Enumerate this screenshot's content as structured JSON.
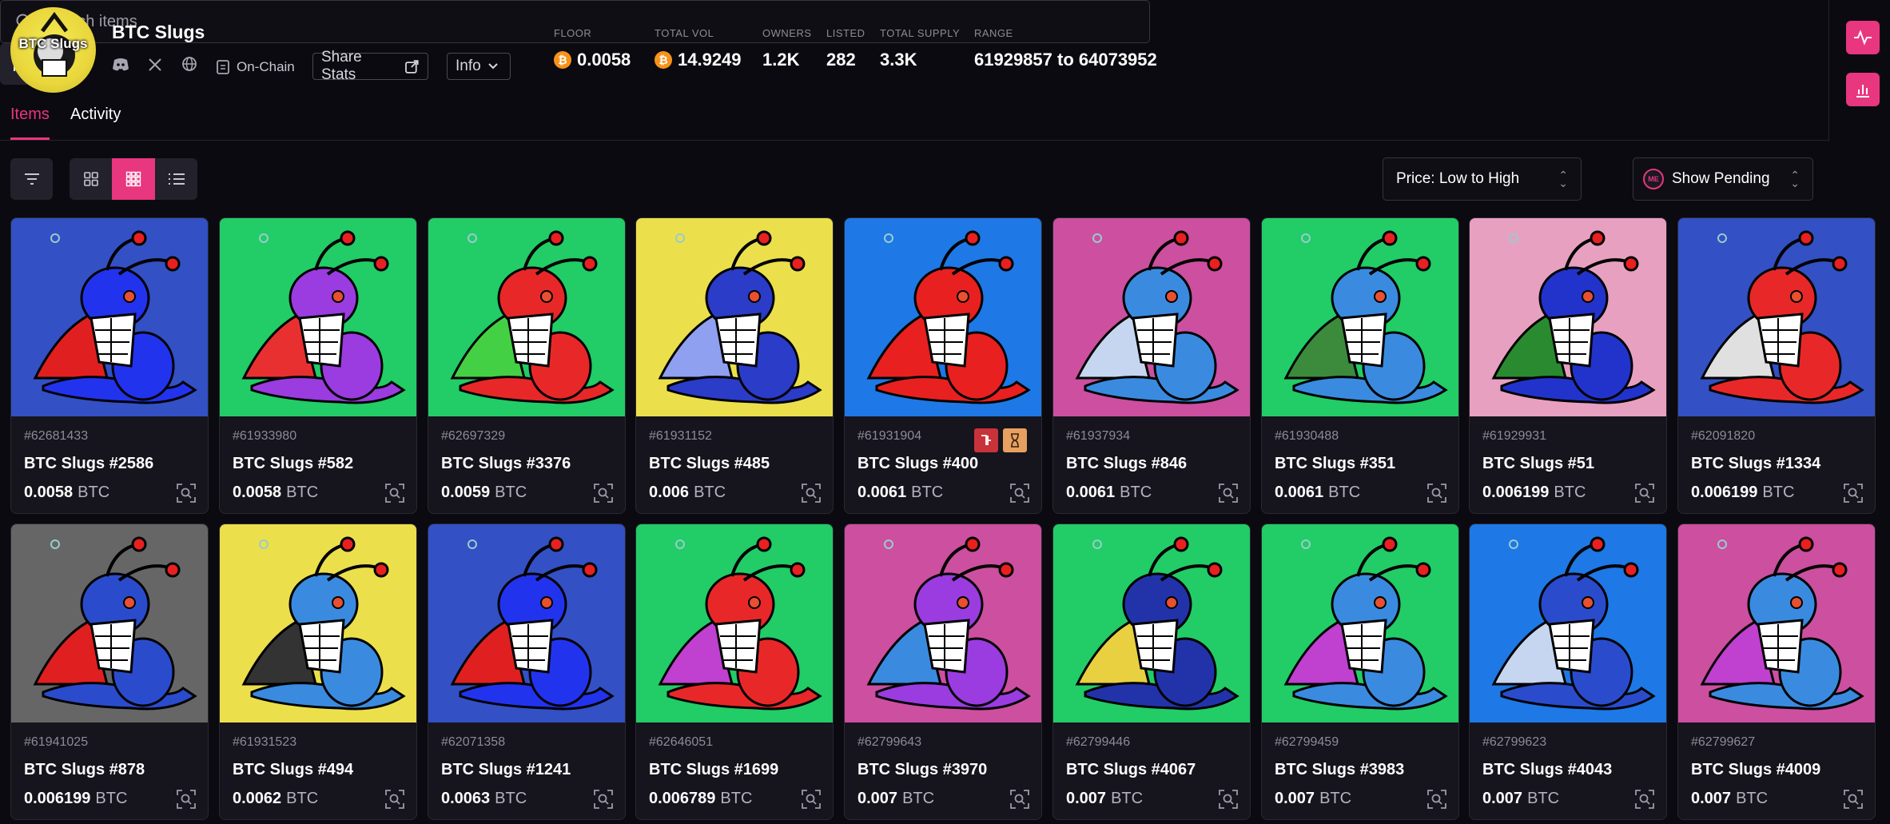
{
  "collection": {
    "name": "BTC Slugs",
    "logo_text": "BTC Slugs"
  },
  "header": {
    "onchain_label": "On-Chain",
    "share_label": "Share Stats",
    "info_label": "Info",
    "stats": [
      {
        "label": "FLOOR",
        "value": "0.0058",
        "btc_icon": true
      },
      {
        "label": "TOTAL VOL",
        "value": "14.9249",
        "btc_icon": true
      },
      {
        "label": "OWNERS",
        "value": "1.2K"
      },
      {
        "label": "LISTED",
        "value": "282"
      },
      {
        "label": "TOTAL SUPPLY",
        "value": "3.3K"
      },
      {
        "label": "RANGE",
        "value": "61929857 to 64073952"
      }
    ]
  },
  "tabs": [
    "Items",
    "Activity"
  ],
  "search": {
    "placeholder": "Search items"
  },
  "sort": {
    "value": "Price: Low to High"
  },
  "pending": {
    "value": "Show Pending",
    "icon_text": "ME"
  },
  "colors": {
    "accent": "#e8367f",
    "bg": "#0b0a10",
    "card": "#16141c",
    "btc": "#f7931a"
  },
  "items": [
    {
      "num": "#62681433",
      "name": "BTC Slugs #2586",
      "price": "0.0058",
      "unit": "BTC",
      "bg": "#3350c4",
      "body": "#2233ee",
      "fin": "#e02020"
    },
    {
      "num": "#61933980",
      "name": "BTC Slugs #582",
      "price": "0.0058",
      "unit": "BTC",
      "bg": "#22cc66",
      "body": "#9a3ce0",
      "fin": "#e83030"
    },
    {
      "num": "#62697329",
      "name": "BTC Slugs #3376",
      "price": "0.0059",
      "unit": "BTC",
      "bg": "#22cc66",
      "body": "#e82828",
      "fin": "#44d044"
    },
    {
      "num": "#61931152",
      "name": "BTC Slugs #485",
      "price": "0.006",
      "unit": "BTC",
      "bg": "#ecdf4c",
      "body": "#2a3cc8",
      "fin": "#8fa0f0"
    },
    {
      "num": "#61931904",
      "name": "BTC Slugs #400",
      "price": "0.0061",
      "unit": "BTC",
      "bg": "#1e78e6",
      "body": "#e82020",
      "fin": "#e82020",
      "badges": true
    },
    {
      "num": "#61937934",
      "name": "BTC Slugs #846",
      "price": "0.0061",
      "unit": "BTC",
      "bg": "#cc4fa0",
      "body": "#3a8be0",
      "fin": "#c6d6f0"
    },
    {
      "num": "#61930488",
      "name": "BTC Slugs #351",
      "price": "0.0061",
      "unit": "BTC",
      "bg": "#22cc66",
      "body": "#3a8be0",
      "fin": "#3c8a3c"
    },
    {
      "num": "#61929931",
      "name": "BTC Slugs #51",
      "price": "0.006199",
      "unit": "BTC",
      "bg": "#e8a0c0",
      "body": "#2233cc",
      "fin": "#2a8a30"
    },
    {
      "num": "#62091820",
      "name": "BTC Slugs #1334",
      "price": "0.006199",
      "unit": "BTC",
      "bg": "#3350c4",
      "body": "#e82828",
      "fin": "#e0e0e0"
    },
    {
      "num": "#61941025",
      "name": "BTC Slugs #878",
      "price": "0.006199",
      "unit": "BTC",
      "bg": "#666666",
      "body": "#2a4ccc",
      "fin": "#e02020"
    },
    {
      "num": "#61931523",
      "name": "BTC Slugs #494",
      "price": "0.0062",
      "unit": "BTC",
      "bg": "#ecdf4c",
      "body": "#3a8be0",
      "fin": "#333333"
    },
    {
      "num": "#62071358",
      "name": "BTC Slugs #1241",
      "price": "0.0063",
      "unit": "BTC",
      "bg": "#3350c4",
      "body": "#2233ee",
      "fin": "#e02020"
    },
    {
      "num": "#62646051",
      "name": "BTC Slugs #1699",
      "price": "0.006789",
      "unit": "BTC",
      "bg": "#22cc66",
      "body": "#e82828",
      "fin": "#c040d0"
    },
    {
      "num": "#62799643",
      "name": "BTC Slugs #3970",
      "price": "0.007",
      "unit": "BTC",
      "bg": "#cc4fa0",
      "body": "#9a3ce0",
      "fin": "#3a8be0"
    },
    {
      "num": "#62799446",
      "name": "BTC Slugs #4067",
      "price": "0.007",
      "unit": "BTC",
      "bg": "#22cc66",
      "body": "#2233aa",
      "fin": "#e8d040"
    },
    {
      "num": "#62799459",
      "name": "BTC Slugs #3983",
      "price": "0.007",
      "unit": "BTC",
      "bg": "#22cc66",
      "body": "#3a8be0",
      "fin": "#c040d0"
    },
    {
      "num": "#62799623",
      "name": "BTC Slugs #4043",
      "price": "0.007",
      "unit": "BTC",
      "bg": "#1e78e6",
      "body": "#2a4ccc",
      "fin": "#c6d6f0"
    },
    {
      "num": "#62799627",
      "name": "BTC Slugs #4009",
      "price": "0.007",
      "unit": "BTC",
      "bg": "#cc4fa0",
      "body": "#3a8be0",
      "fin": "#c040d0"
    }
  ]
}
